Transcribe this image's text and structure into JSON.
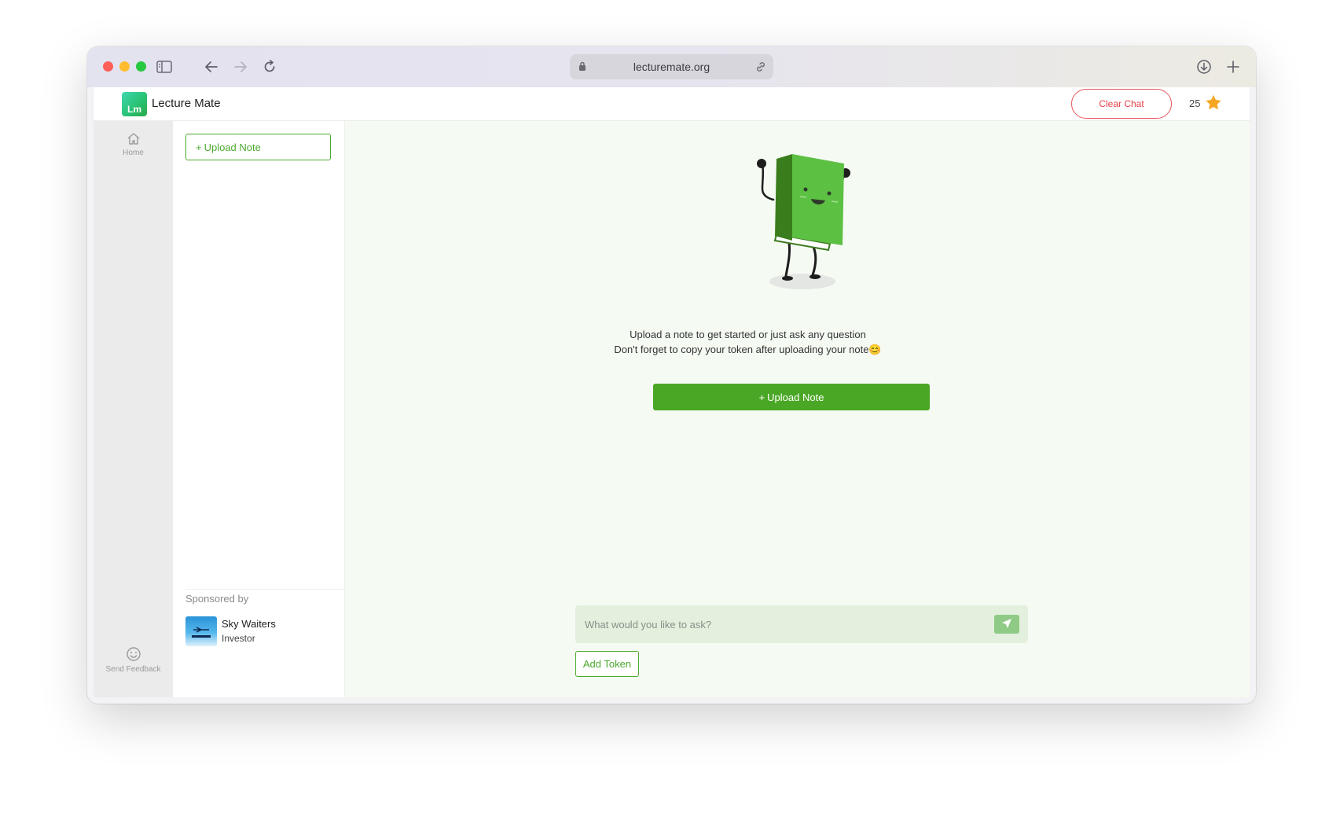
{
  "browser": {
    "url": "lecturemate.org"
  },
  "header": {
    "logo_text": "Lm",
    "brand": "Lecture Mate",
    "clear_chat_label": "Clear Chat",
    "points": "25"
  },
  "rail": {
    "home_label": "Home",
    "feedback_label": "Send Feedback"
  },
  "notes_panel": {
    "upload_label": "Upload Note",
    "sponsor_heading": "Sponsored by",
    "sponsor_name": "Sky Waiters",
    "sponsor_role": "Investor"
  },
  "main": {
    "intro_line1": "Upload a note to get started or just ask any question",
    "intro_line2": "Don't forget to copy your token after uploading your note😊",
    "upload_label": "Upload Note",
    "ask_placeholder": "What would you like to ask?",
    "add_token_label": "Add Token"
  },
  "colors": {
    "accent": "#4aa725",
    "danger": "#e8404a",
    "star": "#f5a623"
  },
  "icons": [
    "sidebar-toggle-icon",
    "back-icon",
    "forward-icon",
    "reload-icon",
    "lock-icon",
    "link-icon",
    "download-icon",
    "new-tab-icon",
    "home-icon",
    "smiley-icon",
    "star-icon",
    "plus-icon",
    "send-icon"
  ]
}
